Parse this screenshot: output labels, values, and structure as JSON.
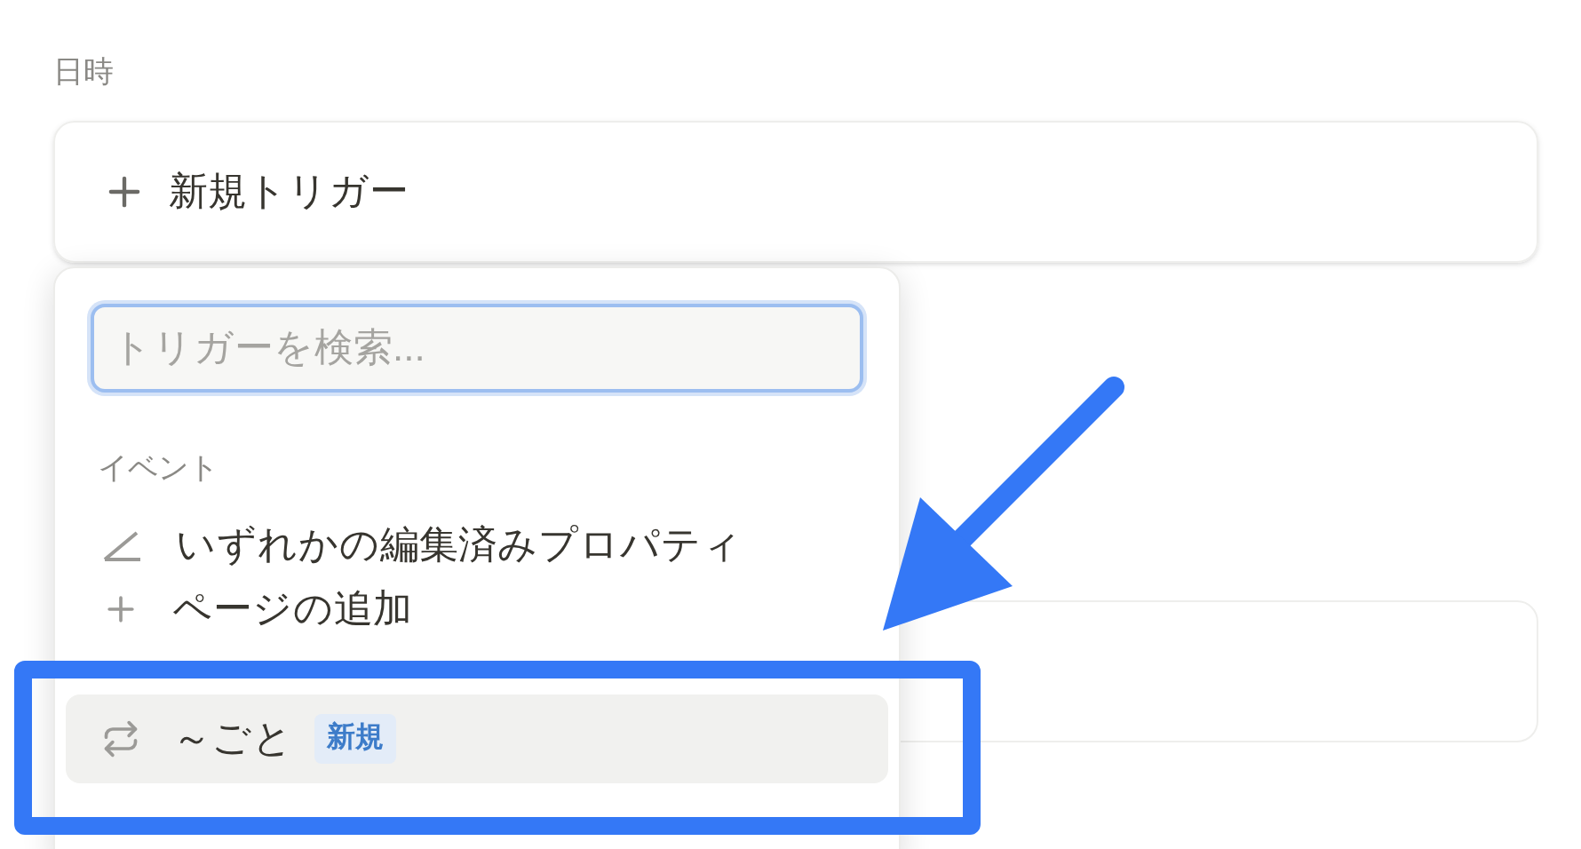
{
  "label": "日時",
  "trigger_button": {
    "label": "新規トリガー"
  },
  "trigger_menu": {
    "search": {
      "placeholder": "トリガーを検索..."
    },
    "section": "イベント",
    "items": [
      {
        "kind": "pencil",
        "label": "いずれかの編集済みプロパティ",
        "selected": false
      },
      {
        "kind": "plus",
        "label": "ページの追加",
        "selected": false
      },
      {
        "kind": "repeat",
        "label": "～ごと",
        "badge": "新規",
        "selected": true
      }
    ]
  }
}
